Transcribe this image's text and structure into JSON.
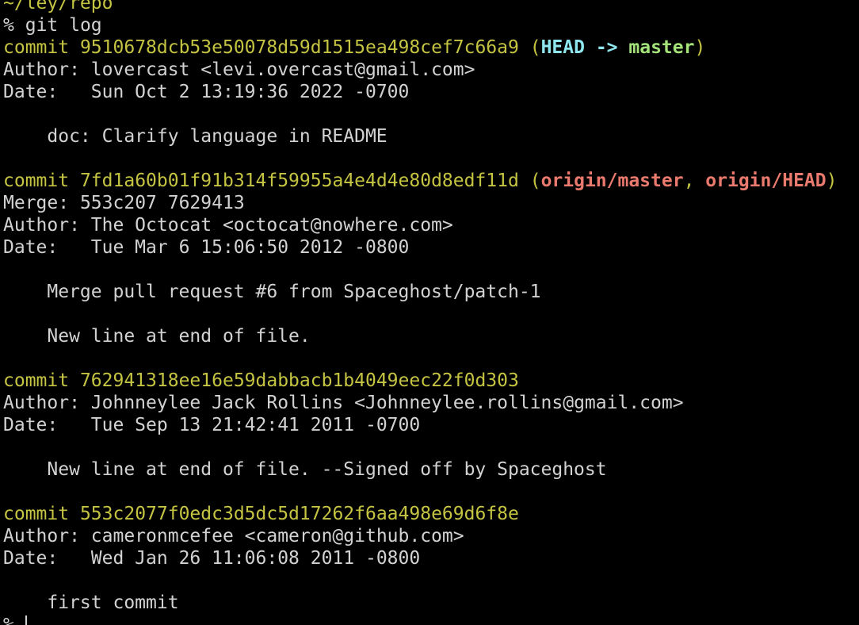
{
  "colors": {
    "background": "#000000",
    "text": "#d2d2d2",
    "commit_yellow": "#c5c442",
    "head_cyan": "#8fe6ee",
    "branch_green": "#a4e27a",
    "remote_red": "#ea7a6e"
  },
  "partial_top_line": "~/ley/repo",
  "prompt": {
    "symbol": "%",
    "command": "git log"
  },
  "commits": [
    {
      "hash": "9510678dcb53e50078d59d1515ea498cef7c66a9",
      "head": "HEAD",
      "arrow": "->",
      "branch": "master",
      "author": "lovercast <levi.overcast@gmail.com>",
      "date": "Sun Oct 2 13:19:36 2022 -0700",
      "message": [
        "doc: Clarify language in README"
      ]
    },
    {
      "hash": "7fd1a60b01f91b314f59955a4e4d4e80d8edf11d",
      "refs": [
        "origin/master",
        "origin/HEAD"
      ],
      "merge": "553c207 7629413",
      "author": "The Octocat <octocat@nowhere.com>",
      "date": "Tue Mar 6 15:06:50 2012 -0800",
      "message": [
        "Merge pull request #6 from Spaceghost/patch-1",
        "New line at end of file."
      ]
    },
    {
      "hash": "762941318ee16e59dabbacb1b4049eec22f0d303",
      "author": "Johnneylee Jack Rollins <Johnneylee.rollins@gmail.com>",
      "date": "Tue Sep 13 21:42:41 2011 -0700",
      "message": [
        "New line at end of file. --Signed off by Spaceghost"
      ]
    },
    {
      "hash": "553c2077f0edc3d5dc5d17262f6aa498e69d6f8e",
      "author": "cameronmcefee <cameron@github.com>",
      "date": "Wed Jan 26 11:06:08 2011 -0800",
      "message": [
        "first commit"
      ]
    }
  ],
  "labels": {
    "commit": "commit",
    "author": "Author:",
    "date": "Date:",
    "merge": "Merge:",
    "paren_open": "(",
    "paren_close": ")",
    "comma": ","
  },
  "final_prompt": {
    "symbol": "%"
  }
}
